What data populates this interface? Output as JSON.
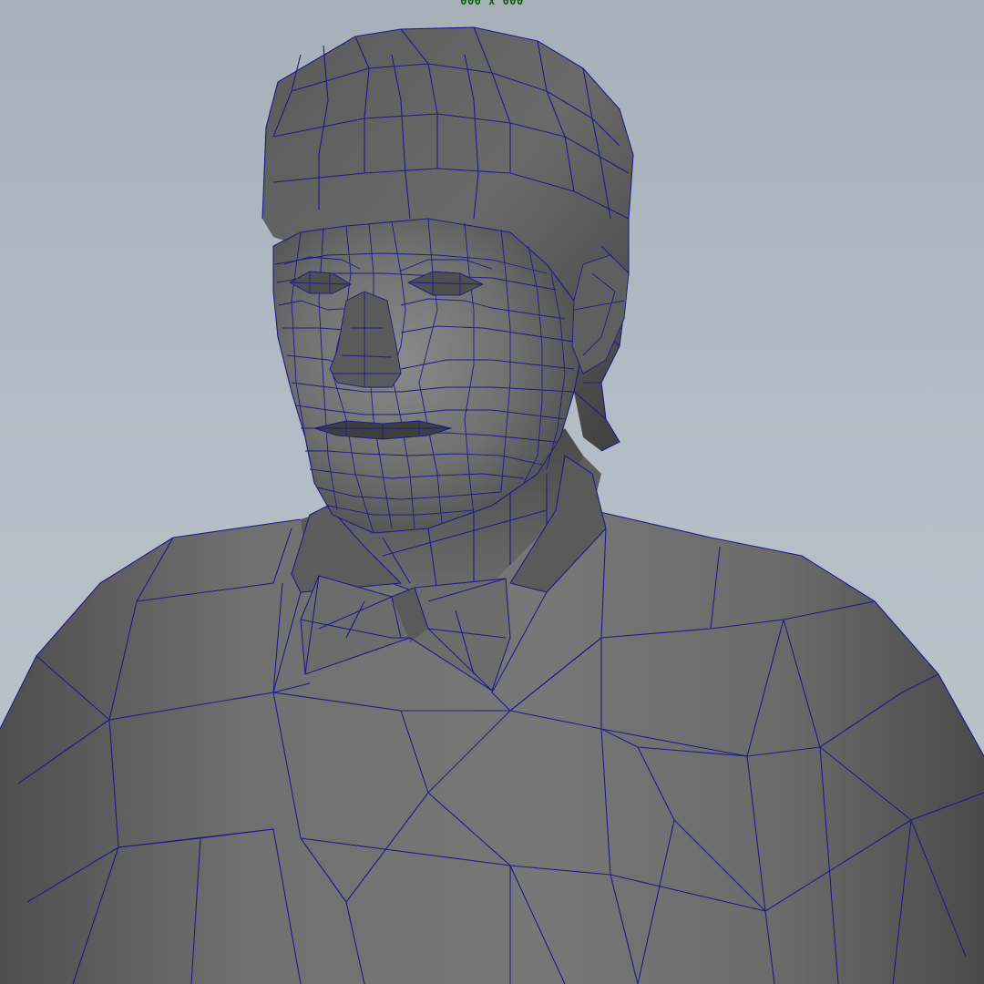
{
  "viewport": {
    "resolution_label": "000 x 000",
    "display_mode": "shaded-wireframe",
    "mesh_subject": "character-bust",
    "colors": {
      "background_top": "#a7b0b9",
      "background_bottom": "#bdc5cc",
      "mesh_shade": "#6e6e6e",
      "wireframe": "#1d1a8c",
      "label": "#0e5a12"
    }
  }
}
